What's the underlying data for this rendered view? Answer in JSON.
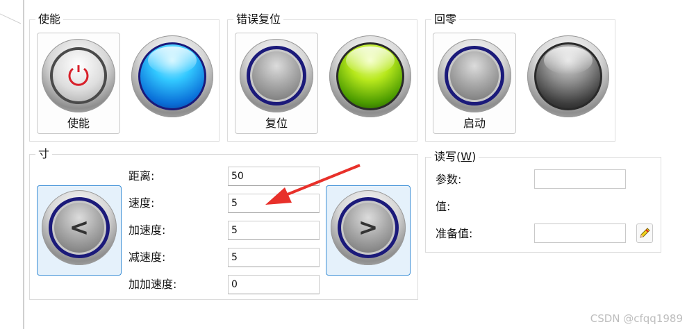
{
  "groups": {
    "enable": {
      "title": "使能",
      "button_label": "使能"
    },
    "reset": {
      "title": "错误复位",
      "button_label": "复位"
    },
    "home": {
      "title": "回零",
      "button_label": "启动"
    },
    "jog": {
      "title": "寸",
      "labels": {
        "distance": "距离:",
        "speed": "速度:",
        "accel": "加速度:",
        "decel": "减速度:",
        "jerk": "加加速度:"
      },
      "values": {
        "distance": "50",
        "speed": "5",
        "accel": "5",
        "decel": "5",
        "jerk": "0"
      },
      "left_glyph": "<",
      "right_glyph": ">"
    },
    "rw": {
      "title_prefix": "读写(",
      "title_key": "W",
      "title_suffix": ")",
      "labels": {
        "param": "参数:",
        "value": "值:",
        "prepare": "准备值:"
      },
      "values": {
        "param": "",
        "prepare": ""
      }
    }
  },
  "annotation": {
    "arrow_color": "#e8302a"
  },
  "icons": {
    "enable_symbol": "power-icon",
    "edit": "pencil-icon"
  },
  "watermark": "CSDN @cfqq1989"
}
